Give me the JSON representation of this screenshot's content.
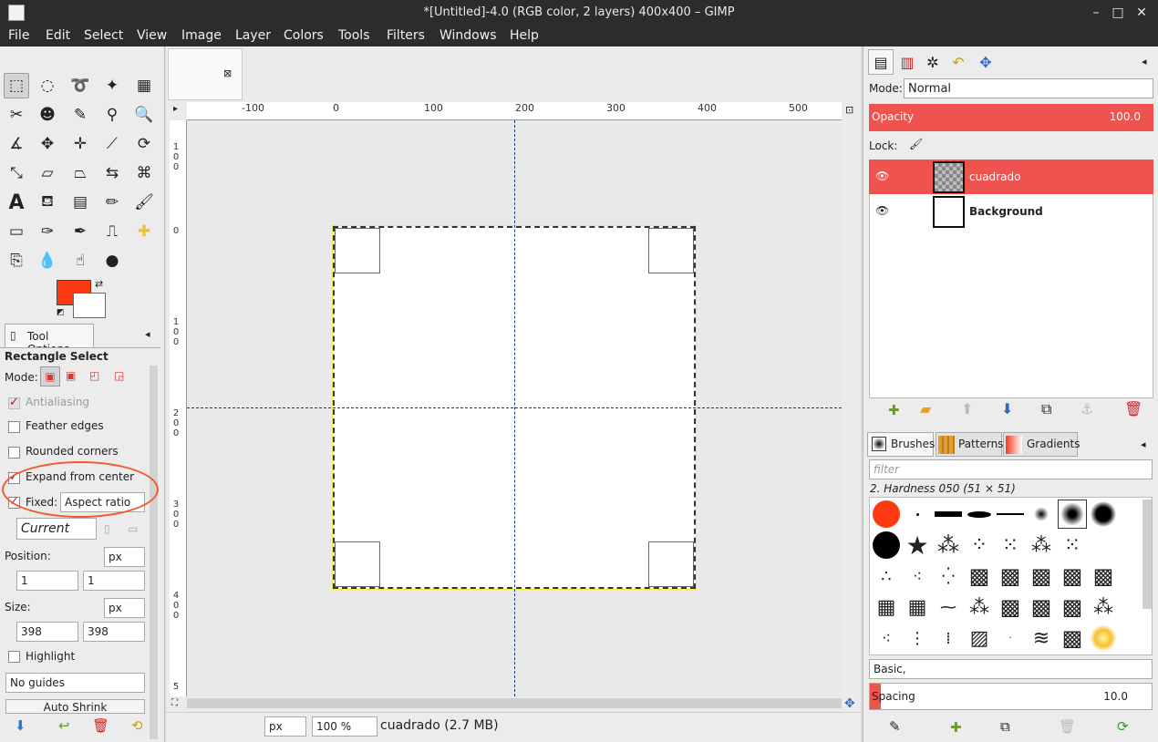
{
  "window": {
    "title": "*[Untitled]-4.0 (RGB color, 2 layers) 400x400 – GIMP"
  },
  "menu": [
    "File",
    "Edit",
    "Select",
    "View",
    "Image",
    "Layer",
    "Colors",
    "Tools",
    "Filters",
    "Windows",
    "Help"
  ],
  "colors": {
    "foreground": "#fe3a12",
    "background": "#ffffff",
    "accent": "#ef5350"
  },
  "tool_options": {
    "tab_label": "Tool Options",
    "tool_name": "Rectangle Select",
    "mode_label": "Mode:",
    "antialiasing": "Antialiasing",
    "feather": "Feather edges",
    "rounded": "Rounded corners",
    "expand": "Expand from center",
    "fixed": "Fixed:",
    "fixed_value": "Aspect ratio",
    "current": "Current",
    "position_label": "Position:",
    "position_unit": "px",
    "pos_x": "1",
    "pos_y": "1",
    "size_label": "Size:",
    "size_unit": "px",
    "size_w": "398",
    "size_h": "398",
    "highlight": "Highlight",
    "guides": "No guides",
    "auto_shrink": "Auto Shrink"
  },
  "ruler": {
    "h_labels": [
      "-100",
      "0",
      "100",
      "200",
      "300",
      "400",
      "500"
    ],
    "v_labels": [
      "100",
      "0",
      "100",
      "200",
      "300",
      "400",
      "5"
    ]
  },
  "status": {
    "unit": "px",
    "zoom": "100 %",
    "info": "cuadrado (2.7 MB)"
  },
  "layers": {
    "mode_label": "Mode:",
    "mode": "Normal",
    "opacity_label": "Opacity",
    "opacity": "100.0",
    "lock_label": "Lock:",
    "items": [
      {
        "name": "cuadrado"
      },
      {
        "name": "Background"
      }
    ]
  },
  "brushes": {
    "tabs": [
      "Brushes",
      "Patterns",
      "Gradients"
    ],
    "filter_placeholder": "filter",
    "selected": "2. Hardness 050 (51 × 51)",
    "tag": "Basic,",
    "spacing_label": "Spacing",
    "spacing": "10.0"
  }
}
